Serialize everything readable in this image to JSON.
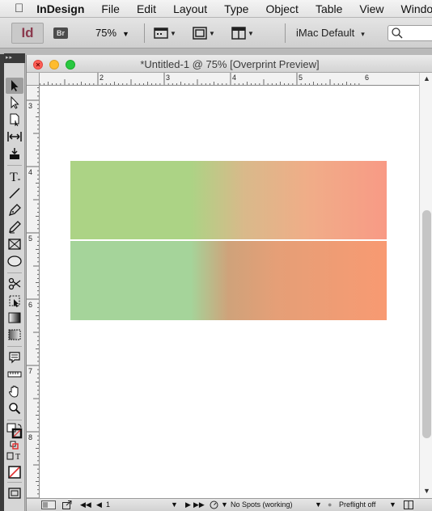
{
  "menubar": {
    "app_name": "InDesign",
    "items": [
      "File",
      "Edit",
      "Layout",
      "Type",
      "Object",
      "Table",
      "View",
      "Windo"
    ]
  },
  "appbar": {
    "logo_text": "Id",
    "bridge_text": "Br",
    "zoom": "75%",
    "workspace": "iMac Default"
  },
  "document": {
    "title": "*Untitled-1 @ 75% [Overprint Preview]",
    "ruler_h_labels": [
      "2",
      "3",
      "4",
      "5",
      "6"
    ],
    "ruler_v_labels": [
      "3",
      "4",
      "5",
      "6",
      "7",
      "8"
    ],
    "gradient_colors": {
      "top_left": "#acd385",
      "top_right": "#f89a85",
      "bottom_left": "#a5d49a",
      "bottom_right": "#f89a72"
    }
  },
  "statusbar": {
    "page_number": "1",
    "spots": "No Spots (working)",
    "preflight": "Preflight off"
  },
  "colors": {
    "accent_red": "#ff5f57",
    "accent_yellow": "#febc2e",
    "accent_green": "#28c840"
  }
}
